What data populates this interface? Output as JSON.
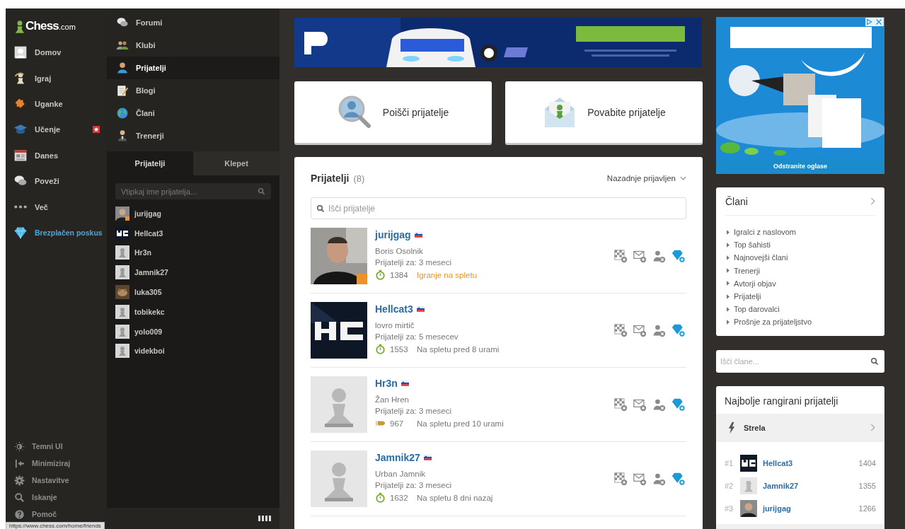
{
  "logo": {
    "name": "Chess",
    "domain": ".com"
  },
  "nav": [
    {
      "label": "Domov",
      "kind": "link",
      "badge": false
    },
    {
      "label": "Igraj",
      "kind": "link",
      "badge": false
    },
    {
      "label": "Uganke",
      "kind": "link",
      "badge": false
    },
    {
      "label": "Učenje",
      "kind": "link",
      "badge": true
    },
    {
      "label": "Danes",
      "kind": "link",
      "badge": false
    },
    {
      "label": "Poveži",
      "kind": "link",
      "badge": false
    },
    {
      "label": "Več",
      "kind": "link",
      "badge": false
    },
    {
      "label": "Brezplačen poskus",
      "kind": "upgrade",
      "badge": false
    }
  ],
  "nav_bottom": [
    "Temni UI",
    "Minimiziraj",
    "Nastavitve",
    "Iskanje",
    "Pomoč"
  ],
  "status_url": "https://www.chess.com/home/friends",
  "submenu": [
    {
      "label": "Forumi",
      "selected": false
    },
    {
      "label": "Klubi",
      "selected": false
    },
    {
      "label": "Prijatelji",
      "selected": true
    },
    {
      "label": "Blogi",
      "selected": false
    },
    {
      "label": "Člani",
      "selected": false
    },
    {
      "label": "Trenerji",
      "selected": false
    }
  ],
  "panel_tabs": [
    {
      "label": "Prijatelji",
      "selected": true
    },
    {
      "label": "Klepet",
      "selected": false
    }
  ],
  "panel_search": {
    "placeholder": "Vtipkaj ime prijatelja..."
  },
  "panel_friends": [
    {
      "name": "jurijgag",
      "playing": true
    },
    {
      "name": "Hellcat3",
      "avatar": {
        "kind": "logo"
      },
      "playing": false
    },
    {
      "name": "Hr3n",
      "avatar": {
        "kind": "pawn"
      },
      "playing": false
    },
    {
      "name": "Jamnik27",
      "avatar": {
        "kind": "pawn"
      },
      "playing": false
    },
    {
      "name": "luka305",
      "avatar": {
        "kind": "animal"
      },
      "playing": false
    },
    {
      "name": "tobikekc",
      "avatar": {
        "kind": "pawn"
      },
      "playing": false
    },
    {
      "name": "yolo009",
      "avatar": {
        "kind": "pawn"
      },
      "playing": false
    },
    {
      "name": "videkboi",
      "avatar": {
        "kind": "pawn"
      },
      "playing": false
    }
  ],
  "action_cards": [
    {
      "label": "Poišči prijatelje"
    },
    {
      "label": "Povabite prijatelje"
    }
  ],
  "friends": {
    "title": "Prijatelji",
    "count": "(8)",
    "sort": "Nazadnje prijavljen",
    "search": {
      "placeholder": "Išči prijatelje"
    },
    "rows": [
      {
        "username": "jurijgag",
        "real_name": "Boris Osolnik",
        "friends_for": "Prijatelji za: 3 meseci",
        "rating": {
          "kind": "rapid",
          "value": "1384"
        },
        "status": "Igranje na spletu",
        "playing": true
      },
      {
        "username": "Hellcat3",
        "avatar": {
          "kind": "logo"
        },
        "real_name": "lovro mirtič",
        "friends_for": "Prijatelji za: 5 mesecev",
        "rating": {
          "kind": "rapid",
          "value": "1553"
        },
        "status": "Na spletu pred 8 urami",
        "playing": false
      },
      {
        "username": "Hr3n",
        "avatar": {
          "kind": "pawn"
        },
        "real_name": "Žan Hren",
        "friends_for": "Prijatelji za: 3 meseci",
        "rating": {
          "kind": "bullet",
          "value": "967"
        },
        "status": "Na spletu pred 10 urami",
        "playing": false
      },
      {
        "username": "Jamnik27",
        "avatar": {
          "kind": "pawn"
        },
        "real_name": "Urban Jamnik",
        "friends_for": "Prijatelji za: 3 meseci",
        "rating": {
          "kind": "rapid",
          "value": "1632"
        },
        "status": "Na spletu 8 dni nazaj",
        "playing": false
      }
    ]
  },
  "ad_side": {
    "remove_link": "Odstranite oglase"
  },
  "members": {
    "title": "Člani",
    "links": [
      "Igralci z naslovom",
      "Top šahisti",
      "Najnovejši člani",
      "Trenerji",
      "Avtorji objav",
      "Prijatelji",
      "Top darovalci",
      "Prošnje za prijateljstvo"
    ]
  },
  "member_search": {
    "placeholder": "Išči člane..."
  },
  "top_rated": {
    "title": "Najbolje rangirani prijatelji",
    "category": "Strela",
    "rows": [
      {
        "rank": "#1",
        "name": "Hellcat3",
        "avatar": {
          "kind": "logo"
        },
        "rating": "1404"
      },
      {
        "rank": "#2",
        "name": "Jamnik27",
        "avatar": {
          "kind": "pawn"
        },
        "rating": "1355"
      },
      {
        "rank": "#3",
        "name": "jurijgag",
        "rating": "1266"
      }
    ]
  }
}
